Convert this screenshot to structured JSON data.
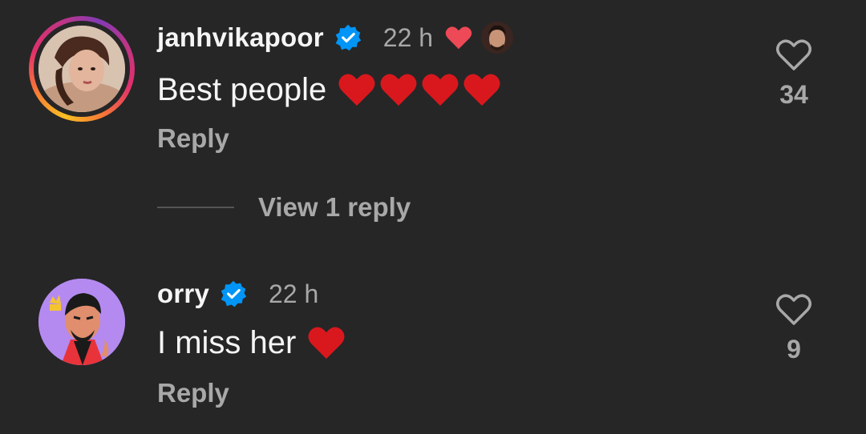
{
  "comments": [
    {
      "username": "janhvikapoor",
      "verified": true,
      "time": "22 h",
      "liked_by_author": true,
      "text": "Best people",
      "emoji_hearts": 4,
      "reply_label": "Reply",
      "view_replies_label": "View 1 reply",
      "like_count": "34"
    },
    {
      "username": "orry",
      "verified": true,
      "time": "22 h",
      "text": "I miss her",
      "emoji_hearts": 1,
      "reply_label": "Reply",
      "like_count": "9"
    }
  ],
  "colors": {
    "background": "#262626",
    "primary_text": "#f5f5f5",
    "secondary_text": "#a8a8a8",
    "verified_blue": "#0095f6",
    "heart_red": "#ed4956",
    "emoji_red": "#d9181e"
  },
  "icons": {
    "verified": "verified-badge-icon",
    "like": "heart-outline-icon",
    "liked_by_author": "heart-filled-icon"
  }
}
